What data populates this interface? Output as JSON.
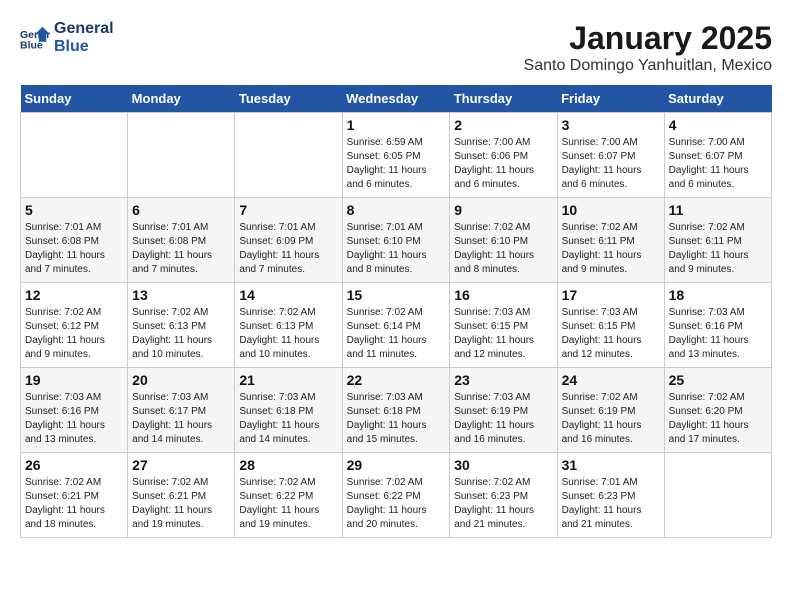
{
  "header": {
    "logo_line1": "General",
    "logo_line2": "Blue",
    "title": "January 2025",
    "subtitle": "Santo Domingo Yanhuitlan, Mexico"
  },
  "days_of_week": [
    "Sunday",
    "Monday",
    "Tuesday",
    "Wednesday",
    "Thursday",
    "Friday",
    "Saturday"
  ],
  "weeks": [
    [
      {
        "num": "",
        "info": ""
      },
      {
        "num": "",
        "info": ""
      },
      {
        "num": "",
        "info": ""
      },
      {
        "num": "1",
        "info": "Sunrise: 6:59 AM\nSunset: 6:05 PM\nDaylight: 11 hours and 6 minutes."
      },
      {
        "num": "2",
        "info": "Sunrise: 7:00 AM\nSunset: 6:06 PM\nDaylight: 11 hours and 6 minutes."
      },
      {
        "num": "3",
        "info": "Sunrise: 7:00 AM\nSunset: 6:07 PM\nDaylight: 11 hours and 6 minutes."
      },
      {
        "num": "4",
        "info": "Sunrise: 7:00 AM\nSunset: 6:07 PM\nDaylight: 11 hours and 6 minutes."
      }
    ],
    [
      {
        "num": "5",
        "info": "Sunrise: 7:01 AM\nSunset: 6:08 PM\nDaylight: 11 hours and 7 minutes."
      },
      {
        "num": "6",
        "info": "Sunrise: 7:01 AM\nSunset: 6:08 PM\nDaylight: 11 hours and 7 minutes."
      },
      {
        "num": "7",
        "info": "Sunrise: 7:01 AM\nSunset: 6:09 PM\nDaylight: 11 hours and 7 minutes."
      },
      {
        "num": "8",
        "info": "Sunrise: 7:01 AM\nSunset: 6:10 PM\nDaylight: 11 hours and 8 minutes."
      },
      {
        "num": "9",
        "info": "Sunrise: 7:02 AM\nSunset: 6:10 PM\nDaylight: 11 hours and 8 minutes."
      },
      {
        "num": "10",
        "info": "Sunrise: 7:02 AM\nSunset: 6:11 PM\nDaylight: 11 hours and 9 minutes."
      },
      {
        "num": "11",
        "info": "Sunrise: 7:02 AM\nSunset: 6:11 PM\nDaylight: 11 hours and 9 minutes."
      }
    ],
    [
      {
        "num": "12",
        "info": "Sunrise: 7:02 AM\nSunset: 6:12 PM\nDaylight: 11 hours and 9 minutes."
      },
      {
        "num": "13",
        "info": "Sunrise: 7:02 AM\nSunset: 6:13 PM\nDaylight: 11 hours and 10 minutes."
      },
      {
        "num": "14",
        "info": "Sunrise: 7:02 AM\nSunset: 6:13 PM\nDaylight: 11 hours and 10 minutes."
      },
      {
        "num": "15",
        "info": "Sunrise: 7:02 AM\nSunset: 6:14 PM\nDaylight: 11 hours and 11 minutes."
      },
      {
        "num": "16",
        "info": "Sunrise: 7:03 AM\nSunset: 6:15 PM\nDaylight: 11 hours and 12 minutes."
      },
      {
        "num": "17",
        "info": "Sunrise: 7:03 AM\nSunset: 6:15 PM\nDaylight: 11 hours and 12 minutes."
      },
      {
        "num": "18",
        "info": "Sunrise: 7:03 AM\nSunset: 6:16 PM\nDaylight: 11 hours and 13 minutes."
      }
    ],
    [
      {
        "num": "19",
        "info": "Sunrise: 7:03 AM\nSunset: 6:16 PM\nDaylight: 11 hours and 13 minutes."
      },
      {
        "num": "20",
        "info": "Sunrise: 7:03 AM\nSunset: 6:17 PM\nDaylight: 11 hours and 14 minutes."
      },
      {
        "num": "21",
        "info": "Sunrise: 7:03 AM\nSunset: 6:18 PM\nDaylight: 11 hours and 14 minutes."
      },
      {
        "num": "22",
        "info": "Sunrise: 7:03 AM\nSunset: 6:18 PM\nDaylight: 11 hours and 15 minutes."
      },
      {
        "num": "23",
        "info": "Sunrise: 7:03 AM\nSunset: 6:19 PM\nDaylight: 11 hours and 16 minutes."
      },
      {
        "num": "24",
        "info": "Sunrise: 7:02 AM\nSunset: 6:19 PM\nDaylight: 11 hours and 16 minutes."
      },
      {
        "num": "25",
        "info": "Sunrise: 7:02 AM\nSunset: 6:20 PM\nDaylight: 11 hours and 17 minutes."
      }
    ],
    [
      {
        "num": "26",
        "info": "Sunrise: 7:02 AM\nSunset: 6:21 PM\nDaylight: 11 hours and 18 minutes."
      },
      {
        "num": "27",
        "info": "Sunrise: 7:02 AM\nSunset: 6:21 PM\nDaylight: 11 hours and 19 minutes."
      },
      {
        "num": "28",
        "info": "Sunrise: 7:02 AM\nSunset: 6:22 PM\nDaylight: 11 hours and 19 minutes."
      },
      {
        "num": "29",
        "info": "Sunrise: 7:02 AM\nSunset: 6:22 PM\nDaylight: 11 hours and 20 minutes."
      },
      {
        "num": "30",
        "info": "Sunrise: 7:02 AM\nSunset: 6:23 PM\nDaylight: 11 hours and 21 minutes."
      },
      {
        "num": "31",
        "info": "Sunrise: 7:01 AM\nSunset: 6:23 PM\nDaylight: 11 hours and 21 minutes."
      },
      {
        "num": "",
        "info": ""
      }
    ]
  ]
}
